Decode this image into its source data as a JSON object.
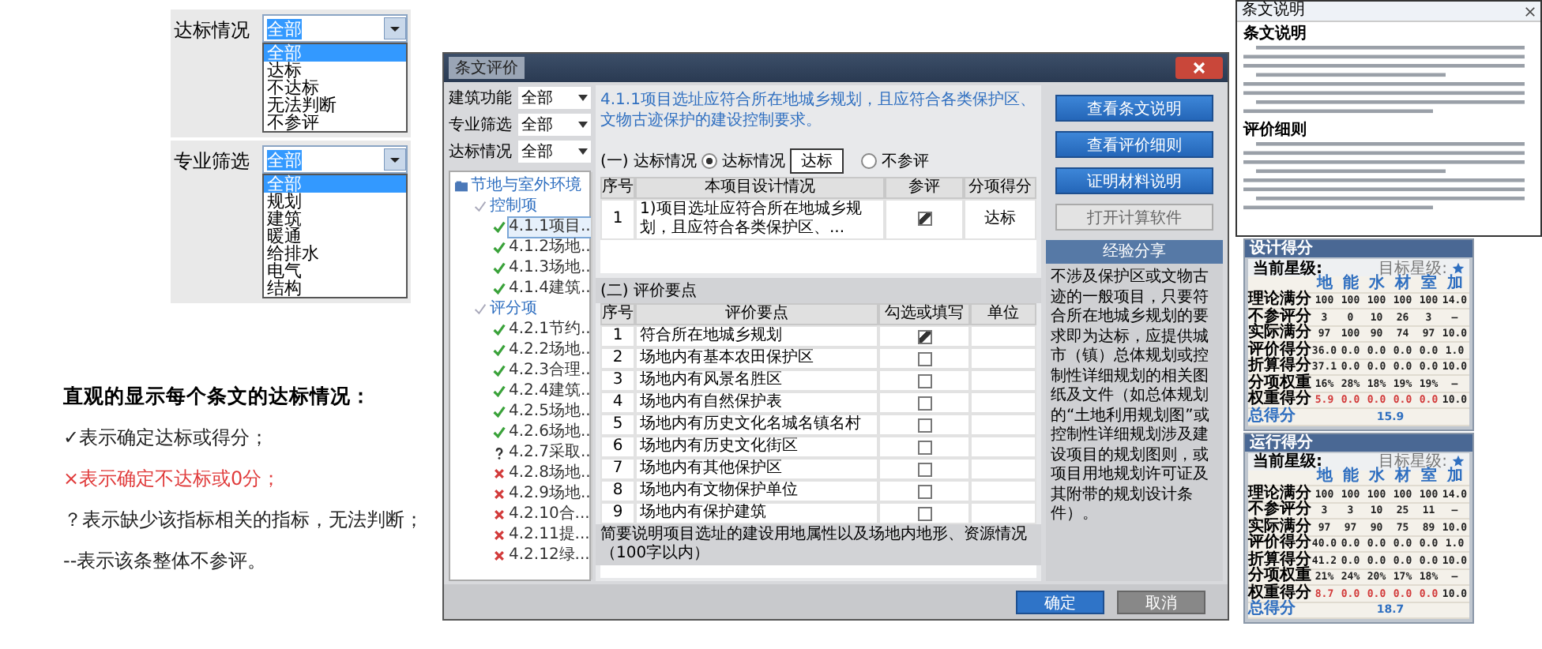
{
  "filter_demos": [
    {
      "label": "达标情况",
      "value": "全部",
      "options": [
        {
          "label": "全部",
          "selected": true
        },
        {
          "label": "达标",
          "selected": false
        },
        {
          "label": "不达标",
          "selected": false
        },
        {
          "label": "无法判断",
          "selected": false
        },
        {
          "label": "不参评",
          "selected": false
        }
      ]
    },
    {
      "label": "专业筛选",
      "value": "全部",
      "options": [
        {
          "label": "全部",
          "selected": true
        },
        {
          "label": "规划",
          "selected": false
        },
        {
          "label": "建筑",
          "selected": false
        },
        {
          "label": "暖通",
          "selected": false
        },
        {
          "label": "给排水",
          "selected": false
        },
        {
          "label": "电气",
          "selected": false
        },
        {
          "label": "结构",
          "selected": false
        }
      ]
    }
  ],
  "legend": {
    "title": "直观的显示每个条文的达标情况：",
    "lines": [
      {
        "text": "✓表示确定达标或得分；",
        "kind": "pass"
      },
      {
        "text": "×表示确定不达标或0分；",
        "kind": "fail"
      },
      {
        "text": "？表示缺少该指标相关的指标，无法判断；",
        "kind": "unknown"
      },
      {
        "text": "--表示该条整体不参评。",
        "kind": "na"
      }
    ]
  },
  "dialog": {
    "title": "条文评价",
    "filters": [
      {
        "label": "建筑功能",
        "value": "全部"
      },
      {
        "label": "专业筛选",
        "value": "全部"
      },
      {
        "label": "达标情况",
        "value": "全部"
      }
    ],
    "tree": [
      {
        "label": "节地与室外环境",
        "children": [
          {
            "label": "控制项",
            "children": [
              {
                "label": "4.1.1项目..",
                "kind": "pass",
                "selected": true
              },
              {
                "label": "4.1.2场地..",
                "kind": "pass",
                "selected": false
              },
              {
                "label": "4.1.3场地..",
                "kind": "pass",
                "selected": false
              },
              {
                "label": "4.1.4建筑..",
                "kind": "pass",
                "selected": false
              }
            ]
          },
          {
            "label": "评分项",
            "children": [
              {
                "label": "4.2.1节约..",
                "kind": "pass",
                "selected": false
              },
              {
                "label": "4.2.2场地..",
                "kind": "pass",
                "selected": false
              },
              {
                "label": "4.2.3合理..",
                "kind": "pass",
                "selected": false
              },
              {
                "label": "4.2.4建筑..",
                "kind": "pass",
                "selected": false
              },
              {
                "label": "4.2.5场地..",
                "kind": "pass",
                "selected": false
              },
              {
                "label": "4.2.6场地..",
                "kind": "pass",
                "selected": false
              },
              {
                "label": "4.2.7采取..",
                "kind": "unknown",
                "selected": false
              },
              {
                "label": "4.2.8场地..",
                "kind": "fail",
                "selected": false
              },
              {
                "label": "4.2.9场地..",
                "kind": "fail",
                "selected": false
              },
              {
                "label": "4.2.10合...",
                "kind": "fail",
                "selected": false
              },
              {
                "label": "4.2.11提...",
                "kind": "fail",
                "selected": false
              },
              {
                "label": "4.2.12绿...",
                "kind": "fail",
                "selected": false
              }
            ]
          }
        ]
      }
    ],
    "clause": "4.1.1项目选址应符合所在地城乡规划，且应符合各类保护区、文物古迹保护的建设控制要求。",
    "section1": {
      "title": "(一) 达标情况",
      "options": [
        {
          "label": "达标情况",
          "selected": true,
          "value": "达标"
        },
        {
          "label": "不参评",
          "selected": false
        }
      ]
    },
    "table1": {
      "columns": [
        "序号",
        "本项目设计情况",
        "参评",
        "分项得分"
      ],
      "rows": [
        {
          "no": "1",
          "text": "1)项目选址应符合所在地城乡规划，且应符合各类保护区、...",
          "checked": true,
          "score": "达标"
        }
      ]
    },
    "section2": {
      "title": "(二) 评价要点"
    },
    "table2": {
      "columns": [
        "序号",
        "评价要点",
        "勾选或填写",
        "单位"
      ],
      "rows": [
        {
          "no": "1",
          "text": "符合所在地城乡规划",
          "checked": true
        },
        {
          "no": "2",
          "text": "场地内有基本农田保护区",
          "checked": false
        },
        {
          "no": "3",
          "text": "场地内有风景名胜区",
          "checked": false
        },
        {
          "no": "4",
          "text": "场地内有自然保护表",
          "checked": false
        },
        {
          "no": "5",
          "text": "场地内有历史文化名城名镇名村",
          "checked": false
        },
        {
          "no": "6",
          "text": "场地内有历史文化街区",
          "checked": false
        },
        {
          "no": "7",
          "text": "场地内有其他保护区",
          "checked": false
        },
        {
          "no": "8",
          "text": "场地内有文物保护单位",
          "checked": false
        },
        {
          "no": "9",
          "text": "场地内有保护建筑",
          "checked": false
        }
      ]
    },
    "note_label": "简要说明项目选址的建设用地属性以及场地内地形、资源情况（100字以内）",
    "side_buttons": [
      {
        "label": "查看条文说明",
        "disabled": false
      },
      {
        "label": "查看评价细则",
        "disabled": false
      },
      {
        "label": "证明材料说明",
        "disabled": false
      },
      {
        "label": "打开计算软件",
        "disabled": true
      }
    ],
    "share": {
      "title": "经验分享",
      "text": "不涉及保护区或文物古迹的一般项目，只要符合所在地城乡规划的要求即为达标，应提供城市（镇）总体规划或控制性详细规划的相关图纸及文件（如总体规划的“土地利用规划图”或控制性详细规划涉及建设项目的规划图则，或项目用地规划许可证及其附带的规划设计条件）。"
    },
    "buttons": [
      {
        "label": "确定",
        "primary": true
      },
      {
        "label": "取消",
        "primary": false
      }
    ]
  },
  "doc_window": {
    "title": "条文说明",
    "headings": [
      "条文说明",
      "评价细则"
    ]
  },
  "score_panels": [
    {
      "title": "设计得分",
      "current": "当前星级:",
      "target": "目标星级:",
      "columns": [
        "地",
        "能",
        "水",
        "材",
        "室",
        "加"
      ],
      "rows": [
        {
          "label": "理论满分",
          "values": [
            "100",
            "100",
            "100",
            "100",
            "100",
            "14.0"
          ],
          "highlight": false
        },
        {
          "label": "不参评分",
          "values": [
            "3",
            "0",
            "10",
            "26",
            "3",
            "—"
          ],
          "highlight": false
        },
        {
          "label": "实际满分",
          "values": [
            "97",
            "100",
            "90",
            "74",
            "97",
            "10.0"
          ],
          "highlight": false
        },
        {
          "label": "评价得分",
          "values": [
            "36.0",
            "0.0",
            "0.0",
            "0.0",
            "0.0",
            "1.0"
          ],
          "highlight": false
        },
        {
          "label": "折算得分",
          "values": [
            "37.1",
            "0.0",
            "0.0",
            "0.0",
            "0.0",
            "10.0"
          ],
          "highlight": false
        },
        {
          "label": "分项权重",
          "values": [
            "16%",
            "28%",
            "18%",
            "19%",
            "19%",
            "—"
          ],
          "highlight": false
        },
        {
          "label": "权重得分",
          "values": [
            "5.9",
            "0.0",
            "0.0",
            "0.0",
            "0.0",
            "10.0"
          ],
          "highlight": true
        }
      ],
      "total_label": "总得分",
      "total": "15.9"
    },
    {
      "title": "运行得分",
      "current": "当前星级:",
      "target": "目标星级:",
      "columns": [
        "地",
        "能",
        "水",
        "材",
        "室",
        "加"
      ],
      "rows": [
        {
          "label": "理论满分",
          "values": [
            "100",
            "100",
            "100",
            "100",
            "100",
            "14.0"
          ],
          "highlight": false
        },
        {
          "label": "不参评分",
          "values": [
            "3",
            "3",
            "10",
            "25",
            "11",
            "—"
          ],
          "highlight": false
        },
        {
          "label": "实际满分",
          "values": [
            "97",
            "97",
            "90",
            "75",
            "89",
            "10.0"
          ],
          "highlight": false
        },
        {
          "label": "评价得分",
          "values": [
            "40.0",
            "0.0",
            "0.0",
            "0.0",
            "0.0",
            "1.0"
          ],
          "highlight": false
        },
        {
          "label": "折算得分",
          "values": [
            "41.2",
            "0.0",
            "0.0",
            "0.0",
            "0.0",
            "10.0"
          ],
          "highlight": false
        },
        {
          "label": "分项权重",
          "values": [
            "21%",
            "24%",
            "20%",
            "17%",
            "18%",
            "—"
          ],
          "highlight": false
        },
        {
          "label": "权重得分",
          "values": [
            "8.7",
            "0.0",
            "0.0",
            "0.0",
            "0.0",
            "10.0"
          ],
          "highlight": true
        }
      ],
      "total_label": "总得分",
      "total": "18.7"
    }
  ]
}
